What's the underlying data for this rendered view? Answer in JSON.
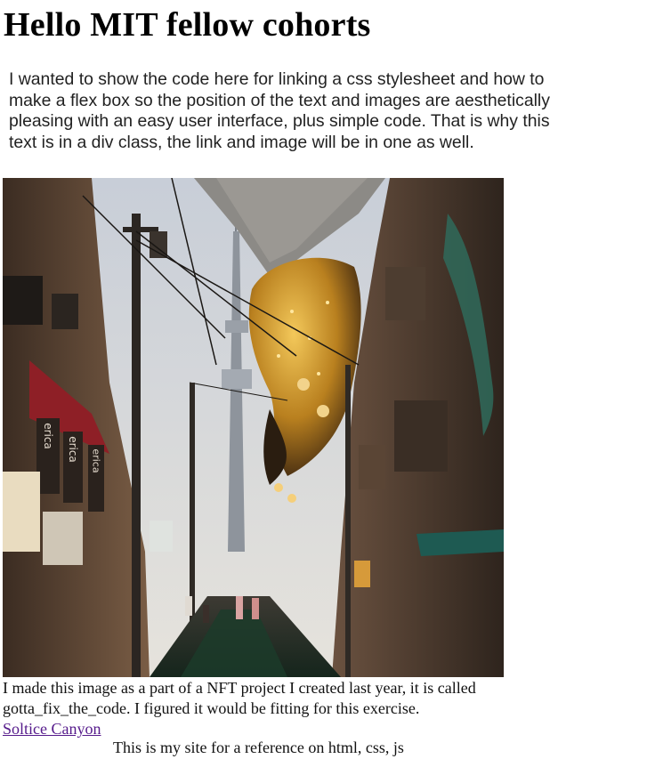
{
  "page": {
    "title": "Hello MIT fellow cohorts",
    "intro": "I wanted to show the code here for linking a css stylesheet and how to make a flex box so the position of the text and images are aesthetically pleasing with an easy user interface, plus simple code. That is why this text is in a div class, the link and image will be in one as well.",
    "image_caption": "I made this image as a part of a NFT project I created last year, it is called gotta_fix_the_code. I figured it would be fitting for this exercise.",
    "link_label": "Soltice Canyon",
    "reference_text": "This is my site for a reference on html, css, js"
  },
  "artwork": {
    "sign_text": "erica",
    "colors": {
      "sky": "#cdd3db",
      "building_left": "#5b4636",
      "building_right": "#4a3a2e",
      "street": "#1f2a24",
      "golden_figure": "#c9952a",
      "awning_red": "#8e1f26",
      "awning_teal": "#1e5a52"
    }
  }
}
